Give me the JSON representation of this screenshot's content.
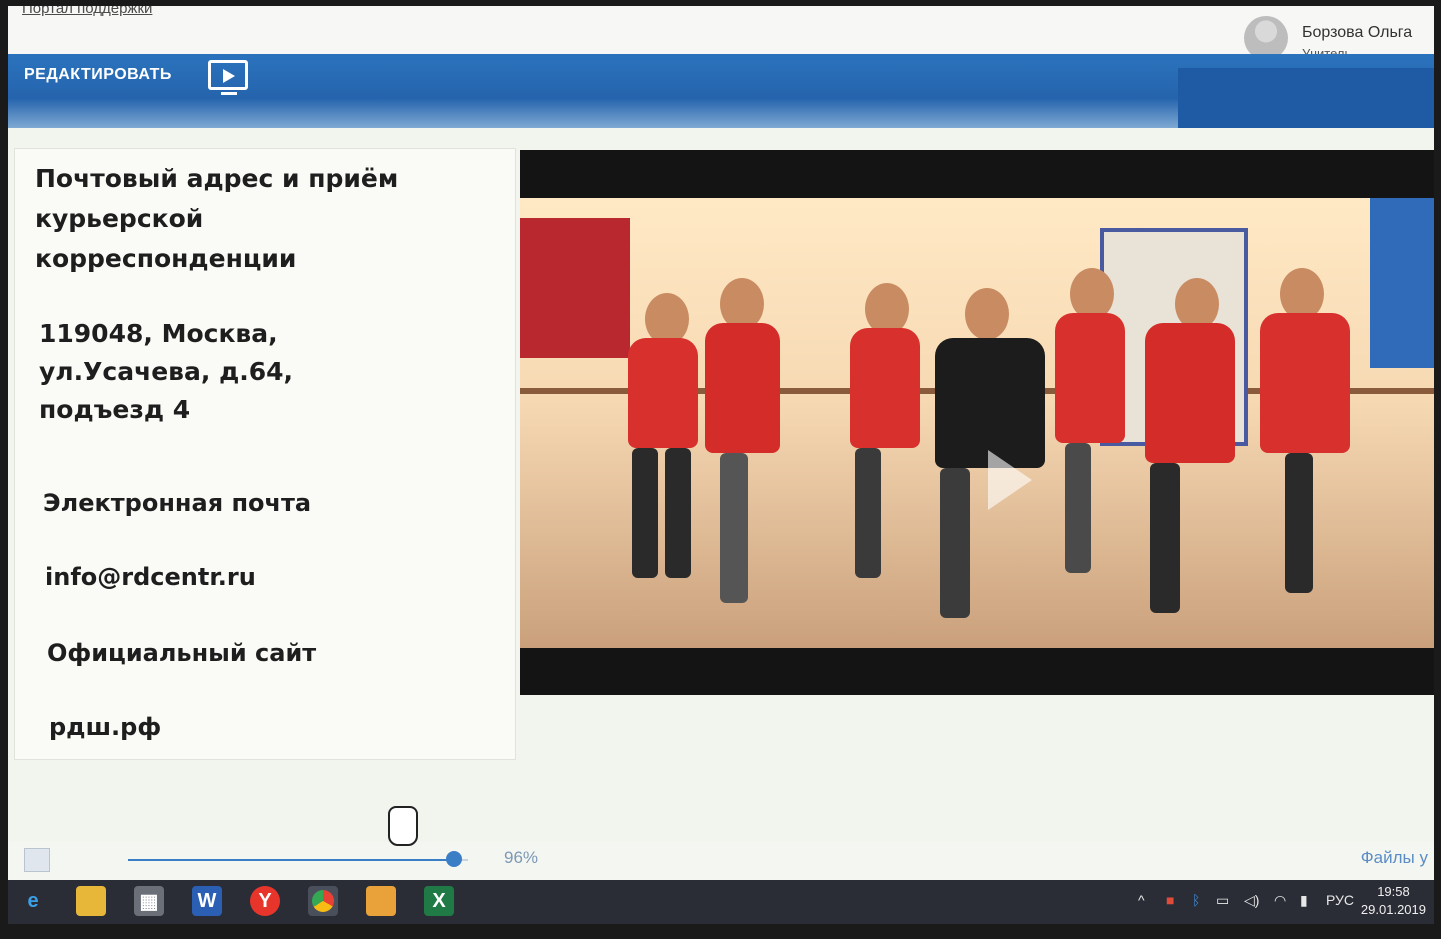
{
  "header": {
    "portal_link": "Портал поддержки",
    "user_name": "Борзова Ольга",
    "user_role": "Учитель"
  },
  "toolbar": {
    "edit_label": "РЕДАКТИРОВАТЬ",
    "present_icon": "presentation-play-icon"
  },
  "slide": {
    "heading": "Почтовый адрес и приём курьерской корреспонденции",
    "address": "119048, Москва, ул.Усачева, д.64, подъезд 4",
    "email_label": "Электронная почта",
    "email": "info@rdcentr.ru",
    "site_label": "Официальный сайт",
    "site": "рдш.рф"
  },
  "footer": {
    "zoom_percent": "96%",
    "zoom_value": 0.96,
    "files_link": "Файлы у"
  },
  "taskbar": {
    "apps": [
      "internet-explorer-icon",
      "file-explorer-icon",
      "calculator-icon",
      "word-icon",
      "yandex-browser-icon",
      "chrome-icon",
      "image-viewer-icon",
      "excel-icon"
    ],
    "language": "РУС",
    "time": "19:58",
    "date": "29.01.2019"
  },
  "colors": {
    "blue_bar": "#2b73bd",
    "accent": "#3a7ec6",
    "taskbar": "#2a2d36"
  }
}
